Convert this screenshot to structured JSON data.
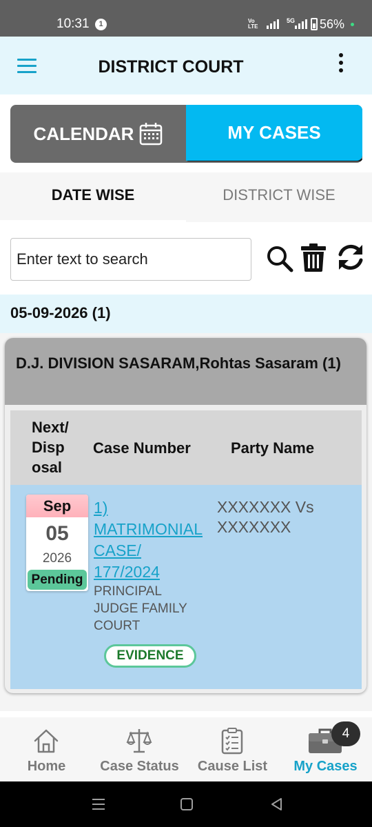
{
  "status_bar": {
    "time": "10:31",
    "notification_count": "1",
    "volte": "Vo LTE",
    "network": "5G",
    "battery": "56%"
  },
  "app_bar": {
    "title": "DISTRICT COURT"
  },
  "segment": {
    "calendar_label": "CALENDAR",
    "my_cases_label": "MY CASES",
    "active": "MY CASES"
  },
  "subtabs": {
    "date_wise": "DATE WISE",
    "district_wise": "DISTRICT WISE",
    "active": "DATE WISE"
  },
  "search": {
    "placeholder": "Enter text to search",
    "value": ""
  },
  "date_group": {
    "header": "05-09-2026 (1)"
  },
  "court_card": {
    "title": "D.J. DIVISION SASARAM,Rohtas Sasaram (1)",
    "columns": {
      "next": "Next/ Disp osal",
      "case_number": "Case Number",
      "party_name": "Party Name"
    },
    "rows": [
      {
        "month": "Sep",
        "day": "05",
        "year": "2026",
        "status": "Pending",
        "case_number": "1) MATRIMONIAL CASE/ 177/2024",
        "court": "PRINCIPAL JUDGE FAMILY COURT",
        "stage": "EVIDENCE",
        "party": "XXXXXXX Vs XXXXXXX"
      }
    ]
  },
  "bottom_nav": {
    "items": [
      {
        "label": "Home",
        "icon": "home-icon"
      },
      {
        "label": "Case Status",
        "icon": "scales-icon"
      },
      {
        "label": "Cause List",
        "icon": "clipboard-icon"
      },
      {
        "label": "My Cases",
        "icon": "briefcase-icon"
      }
    ],
    "active": "My Cases",
    "badge": "4"
  },
  "colors": {
    "accent": "#03b9f1",
    "link": "#17a2c9",
    "app_bar_bg": "#e4f6fc",
    "pending": "#5cc79a",
    "row_bg": "#b1d6f0"
  }
}
